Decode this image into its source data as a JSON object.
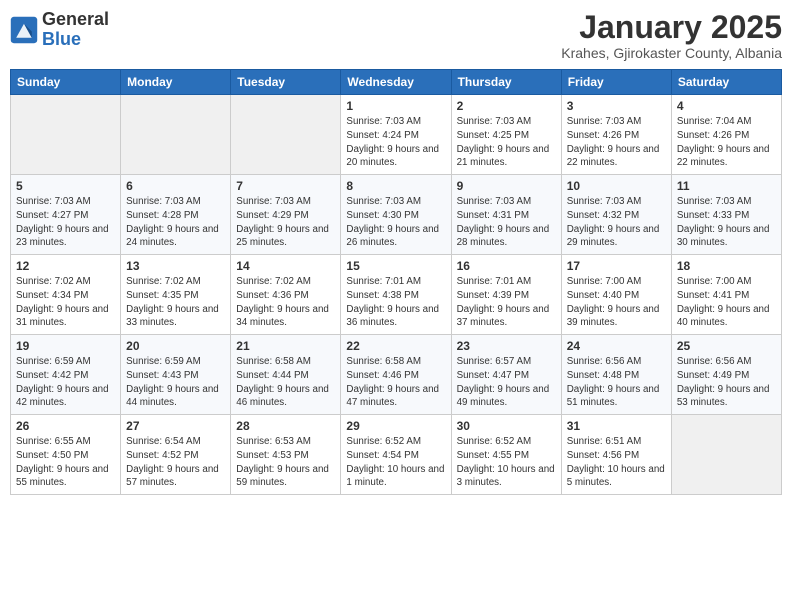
{
  "logo": {
    "general": "General",
    "blue": "Blue"
  },
  "header": {
    "month": "January 2025",
    "location": "Krahes, Gjirokaster County, Albania"
  },
  "weekdays": [
    "Sunday",
    "Monday",
    "Tuesday",
    "Wednesday",
    "Thursday",
    "Friday",
    "Saturday"
  ],
  "weeks": [
    [
      {
        "day": "",
        "empty": true
      },
      {
        "day": "",
        "empty": true
      },
      {
        "day": "",
        "empty": true
      },
      {
        "day": "1",
        "sunrise": "7:03 AM",
        "sunset": "4:24 PM",
        "daylight": "9 hours and 20 minutes."
      },
      {
        "day": "2",
        "sunrise": "7:03 AM",
        "sunset": "4:25 PM",
        "daylight": "9 hours and 21 minutes."
      },
      {
        "day": "3",
        "sunrise": "7:03 AM",
        "sunset": "4:26 PM",
        "daylight": "9 hours and 22 minutes."
      },
      {
        "day": "4",
        "sunrise": "7:04 AM",
        "sunset": "4:26 PM",
        "daylight": "9 hours and 22 minutes."
      }
    ],
    [
      {
        "day": "5",
        "sunrise": "7:03 AM",
        "sunset": "4:27 PM",
        "daylight": "9 hours and 23 minutes."
      },
      {
        "day": "6",
        "sunrise": "7:03 AM",
        "sunset": "4:28 PM",
        "daylight": "9 hours and 24 minutes."
      },
      {
        "day": "7",
        "sunrise": "7:03 AM",
        "sunset": "4:29 PM",
        "daylight": "9 hours and 25 minutes."
      },
      {
        "day": "8",
        "sunrise": "7:03 AM",
        "sunset": "4:30 PM",
        "daylight": "9 hours and 26 minutes."
      },
      {
        "day": "9",
        "sunrise": "7:03 AM",
        "sunset": "4:31 PM",
        "daylight": "9 hours and 28 minutes."
      },
      {
        "day": "10",
        "sunrise": "7:03 AM",
        "sunset": "4:32 PM",
        "daylight": "9 hours and 29 minutes."
      },
      {
        "day": "11",
        "sunrise": "7:03 AM",
        "sunset": "4:33 PM",
        "daylight": "9 hours and 30 minutes."
      }
    ],
    [
      {
        "day": "12",
        "sunrise": "7:02 AM",
        "sunset": "4:34 PM",
        "daylight": "9 hours and 31 minutes."
      },
      {
        "day": "13",
        "sunrise": "7:02 AM",
        "sunset": "4:35 PM",
        "daylight": "9 hours and 33 minutes."
      },
      {
        "day": "14",
        "sunrise": "7:02 AM",
        "sunset": "4:36 PM",
        "daylight": "9 hours and 34 minutes."
      },
      {
        "day": "15",
        "sunrise": "7:01 AM",
        "sunset": "4:38 PM",
        "daylight": "9 hours and 36 minutes."
      },
      {
        "day": "16",
        "sunrise": "7:01 AM",
        "sunset": "4:39 PM",
        "daylight": "9 hours and 37 minutes."
      },
      {
        "day": "17",
        "sunrise": "7:00 AM",
        "sunset": "4:40 PM",
        "daylight": "9 hours and 39 minutes."
      },
      {
        "day": "18",
        "sunrise": "7:00 AM",
        "sunset": "4:41 PM",
        "daylight": "9 hours and 40 minutes."
      }
    ],
    [
      {
        "day": "19",
        "sunrise": "6:59 AM",
        "sunset": "4:42 PM",
        "daylight": "9 hours and 42 minutes."
      },
      {
        "day": "20",
        "sunrise": "6:59 AM",
        "sunset": "4:43 PM",
        "daylight": "9 hours and 44 minutes."
      },
      {
        "day": "21",
        "sunrise": "6:58 AM",
        "sunset": "4:44 PM",
        "daylight": "9 hours and 46 minutes."
      },
      {
        "day": "22",
        "sunrise": "6:58 AM",
        "sunset": "4:46 PM",
        "daylight": "9 hours and 47 minutes."
      },
      {
        "day": "23",
        "sunrise": "6:57 AM",
        "sunset": "4:47 PM",
        "daylight": "9 hours and 49 minutes."
      },
      {
        "day": "24",
        "sunrise": "6:56 AM",
        "sunset": "4:48 PM",
        "daylight": "9 hours and 51 minutes."
      },
      {
        "day": "25",
        "sunrise": "6:56 AM",
        "sunset": "4:49 PM",
        "daylight": "9 hours and 53 minutes."
      }
    ],
    [
      {
        "day": "26",
        "sunrise": "6:55 AM",
        "sunset": "4:50 PM",
        "daylight": "9 hours and 55 minutes."
      },
      {
        "day": "27",
        "sunrise": "6:54 AM",
        "sunset": "4:52 PM",
        "daylight": "9 hours and 57 minutes."
      },
      {
        "day": "28",
        "sunrise": "6:53 AM",
        "sunset": "4:53 PM",
        "daylight": "9 hours and 59 minutes."
      },
      {
        "day": "29",
        "sunrise": "6:52 AM",
        "sunset": "4:54 PM",
        "daylight": "10 hours and 1 minute."
      },
      {
        "day": "30",
        "sunrise": "6:52 AM",
        "sunset": "4:55 PM",
        "daylight": "10 hours and 3 minutes."
      },
      {
        "day": "31",
        "sunrise": "6:51 AM",
        "sunset": "4:56 PM",
        "daylight": "10 hours and 5 minutes."
      },
      {
        "day": "",
        "empty": true
      }
    ]
  ]
}
